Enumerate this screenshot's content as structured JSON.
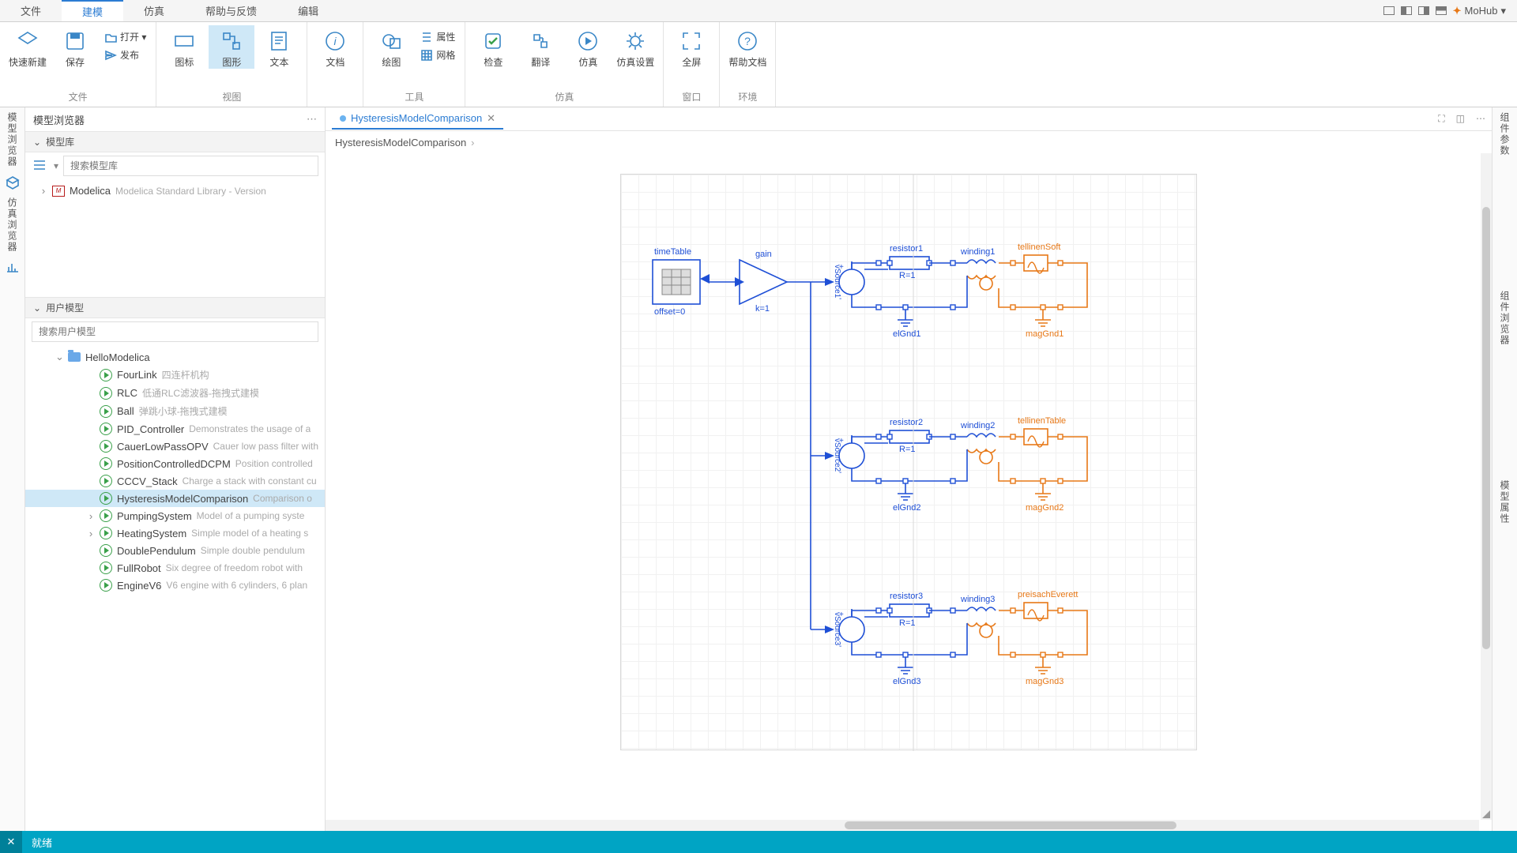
{
  "menu": {
    "tabs": [
      "文件",
      "建模",
      "仿真",
      "帮助与反馈",
      "编辑"
    ],
    "active": 1
  },
  "titlebar": {
    "brand": "MoHub"
  },
  "ribbon": {
    "groups": [
      {
        "label": "文件",
        "big": [
          {
            "name": "quick-new",
            "label": "快速新建"
          },
          {
            "name": "save",
            "label": "保存"
          }
        ],
        "small": [
          {
            "name": "open",
            "label": "打开 ▾"
          },
          {
            "name": "publish",
            "label": "发布"
          }
        ]
      },
      {
        "label": "视图",
        "big": [
          {
            "name": "icon-view",
            "label": "图标"
          },
          {
            "name": "graph-view",
            "label": "图形",
            "selected": true
          },
          {
            "name": "text-view",
            "label": "文本"
          }
        ]
      },
      {
        "label": "",
        "big": [
          {
            "name": "doc",
            "label": "文档"
          }
        ]
      },
      {
        "label": "工具",
        "big": [
          {
            "name": "draw",
            "label": "绘图"
          }
        ],
        "small": [
          {
            "name": "attrs",
            "label": "属性"
          },
          {
            "name": "grid",
            "label": "网格"
          }
        ]
      },
      {
        "label": "仿真",
        "big": [
          {
            "name": "check",
            "label": "检查"
          },
          {
            "name": "translate",
            "label": "翻译"
          },
          {
            "name": "simulate",
            "label": "仿真"
          },
          {
            "name": "sim-settings",
            "label": "仿真设置"
          }
        ]
      },
      {
        "label": "窗口",
        "big": [
          {
            "name": "fullscreen",
            "label": "全屏"
          }
        ]
      },
      {
        "label": "环境",
        "big": [
          {
            "name": "help-doc",
            "label": "帮助文档"
          }
        ]
      }
    ]
  },
  "left_strip": {
    "items": [
      "模型浏览器",
      "仿真浏览器"
    ]
  },
  "right_strip": {
    "items": [
      "组件参数",
      "组件浏览器",
      "模型属性"
    ]
  },
  "browser": {
    "title": "模型浏览器",
    "modellib": {
      "header": "模型库",
      "search_placeholder": "搜索模型库",
      "root": {
        "name": "Modelica",
        "desc": "Modelica Standard Library - Version"
      }
    },
    "usermodel": {
      "header": "用户模型",
      "search_placeholder": "搜索用户模型",
      "root": "HelloModelica",
      "items": [
        {
          "name": "FourLink",
          "desc": "四连杆机构"
        },
        {
          "name": "RLC",
          "desc": "低通RLC滤波器-拖拽式建模"
        },
        {
          "name": "Ball",
          "desc": "弹跳小球-拖拽式建模"
        },
        {
          "name": "PID_Controller",
          "desc": "Demonstrates the usage of a"
        },
        {
          "name": "CauerLowPassOPV",
          "desc": "Cauer low pass filter with"
        },
        {
          "name": "PositionControlledDCPM",
          "desc": "Position controlled"
        },
        {
          "name": "CCCV_Stack",
          "desc": "Charge a stack with constant cu"
        },
        {
          "name": "HysteresisModelComparison",
          "desc": "Comparison o",
          "selected": true
        },
        {
          "name": "PumpingSystem",
          "desc": "Model of a pumping syste",
          "expandable": true
        },
        {
          "name": "HeatingSystem",
          "desc": "Simple model of a heating s",
          "expandable": true
        },
        {
          "name": "DoublePendulum",
          "desc": "Simple double pendulum"
        },
        {
          "name": "FullRobot",
          "desc": "Six degree of freedom robot with"
        },
        {
          "name": "EngineV6",
          "desc": "V6 engine with 6 cylinders, 6 plan"
        }
      ]
    }
  },
  "doc": {
    "tab": "HysteresisModelComparison",
    "breadcrumb": "HysteresisModelComparison"
  },
  "diagram": {
    "timeTable": {
      "name": "timeTable",
      "offset": "offset=0"
    },
    "gain": {
      "name": "gain",
      "k": "k=1"
    },
    "rows": [
      {
        "vsrc": "vSource1",
        "resistor": "resistor1",
        "r": "R=1",
        "winding": "winding1",
        "elgnd": "elGnd1",
        "mag": "tellinenSoft",
        "maggnd": "magGnd1"
      },
      {
        "vsrc": "vSource2",
        "resistor": "resistor2",
        "r": "R=1",
        "winding": "winding2",
        "elgnd": "elGnd2",
        "mag": "tellinenTable",
        "maggnd": "magGnd2"
      },
      {
        "vsrc": "vSource3",
        "resistor": "resistor3",
        "r": "R=1",
        "winding": "winding3",
        "elgnd": "elGnd3",
        "mag": "preisachEverett",
        "maggnd": "magGnd3"
      }
    ]
  },
  "status": {
    "text": "就绪"
  }
}
